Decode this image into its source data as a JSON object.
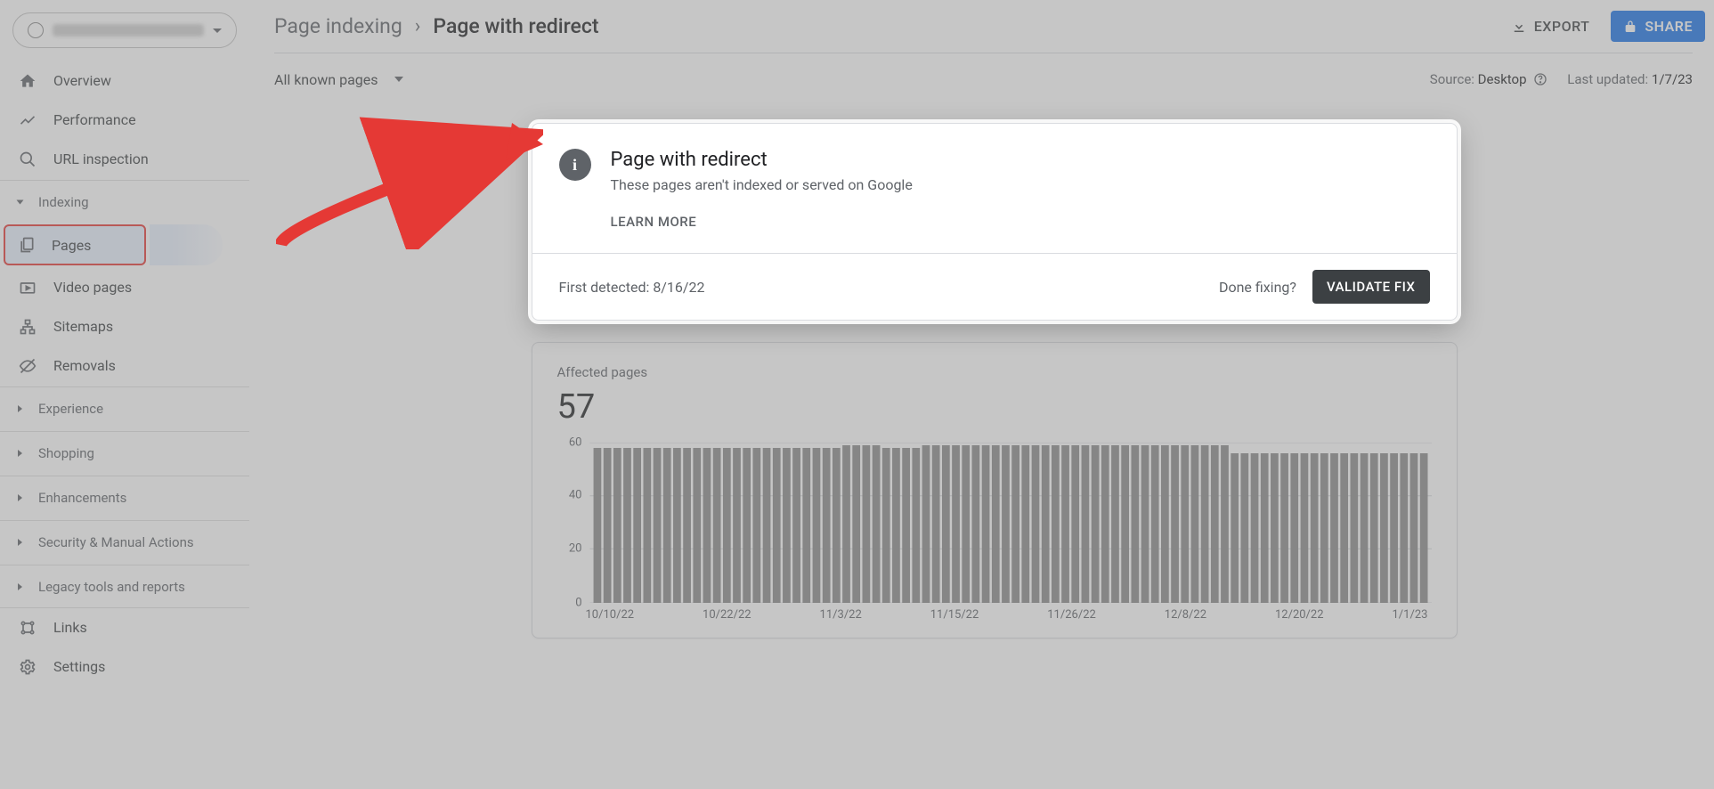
{
  "sidebar": {
    "items": {
      "overview": "Overview",
      "performance": "Performance",
      "url_inspection": "URL inspection",
      "indexing": "Indexing",
      "pages": "Pages",
      "video_pages": "Video pages",
      "sitemaps": "Sitemaps",
      "removals": "Removals",
      "experience": "Experience",
      "shopping": "Shopping",
      "enhancements": "Enhancements",
      "security": "Security & Manual Actions",
      "legacy": "Legacy tools and reports",
      "links": "Links",
      "settings": "Settings"
    }
  },
  "breadcrumb": {
    "parent": "Page indexing",
    "current": "Page with redirect"
  },
  "header": {
    "export": "EXPORT",
    "share": "SHARE"
  },
  "filter": {
    "dropdown": "All known pages",
    "source_label": "Source:",
    "source_value": "Desktop",
    "updated_label": "Last updated:",
    "updated_value": "1/7/23"
  },
  "info": {
    "title": "Page with redirect",
    "subtitle": "These pages aren't indexed or served on Google",
    "learn_more": "LEARN MORE",
    "first_detected_label": "First detected:",
    "first_detected_value": "8/16/22",
    "done_fixing": "Done fixing?",
    "validate": "VALIDATE FIX"
  },
  "chart": {
    "label": "Affected pages",
    "value": "57"
  },
  "chart_data": {
    "type": "bar",
    "title": "Affected pages",
    "xlabel": "",
    "ylabel": "",
    "ylim": [
      0,
      60
    ],
    "y_ticks": [
      0,
      20,
      40,
      60
    ],
    "x_tick_labels": [
      "10/10/22",
      "10/22/22",
      "11/3/22",
      "11/15/22",
      "11/26/22",
      "12/8/22",
      "12/20/22",
      "1/1/23"
    ],
    "values": [
      58,
      58,
      58,
      58,
      58,
      58,
      58,
      58,
      58,
      58,
      58,
      58,
      58,
      58,
      58,
      58,
      58,
      58,
      58,
      58,
      58,
      58,
      58,
      58,
      58,
      59,
      59,
      59,
      59,
      58,
      58,
      58,
      58,
      59,
      59,
      59,
      59,
      59,
      59,
      59,
      59,
      59,
      59,
      59,
      59,
      59,
      59,
      59,
      59,
      59,
      59,
      59,
      59,
      59,
      59,
      59,
      59,
      59,
      59,
      59,
      59,
      59,
      59,
      59,
      56,
      56,
      56,
      56,
      56,
      56,
      56,
      56,
      56,
      56,
      56,
      56,
      56,
      56,
      56,
      56,
      56,
      56,
      56,
      56
    ]
  }
}
